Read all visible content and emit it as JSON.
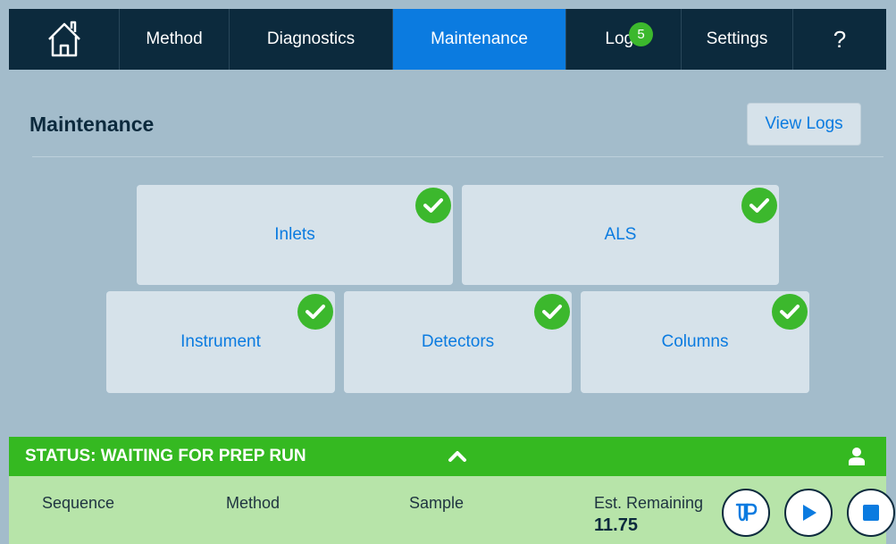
{
  "nav": {
    "items": [
      {
        "label": "Method"
      },
      {
        "label": "Diagnostics"
      },
      {
        "label": "Maintenance"
      },
      {
        "label": "Logs",
        "badge": "5"
      },
      {
        "label": "Settings"
      },
      {
        "label": "?"
      }
    ],
    "active": "Maintenance"
  },
  "page": {
    "title": "Maintenance",
    "view_logs_label": "View Logs"
  },
  "tiles": [
    {
      "label": "Inlets",
      "status": "ok"
    },
    {
      "label": "ALS",
      "status": "ok"
    },
    {
      "label": "Instrument",
      "status": "ok"
    },
    {
      "label": "Detectors",
      "status": "ok"
    },
    {
      "label": "Columns",
      "status": "ok"
    }
  ],
  "status": {
    "text": "STATUS: WAITING FOR PREP RUN"
  },
  "bottom": {
    "sequence_label": "Sequence",
    "method_label": "Method",
    "sample_label": "Sample",
    "est_remaining_label": "Est. Remaining",
    "est_remaining_value": "11.75"
  },
  "icons": {
    "home": "home-icon",
    "check": "check-circle-icon",
    "chevron": "chevron-up-icon",
    "user": "user-icon",
    "prep": "prep-run-icon",
    "play": "play-icon",
    "stop": "stop-icon"
  },
  "colors": {
    "nav_bg": "#0c2a3d",
    "active_tab": "#0b7be0",
    "page_bg": "#a3bccb",
    "tile_bg": "#d6e2ea",
    "accent_text": "#0b7be0",
    "status_green": "#35b921",
    "bottom_bg": "#b7e4a9",
    "check_green": "#3cb82d"
  }
}
